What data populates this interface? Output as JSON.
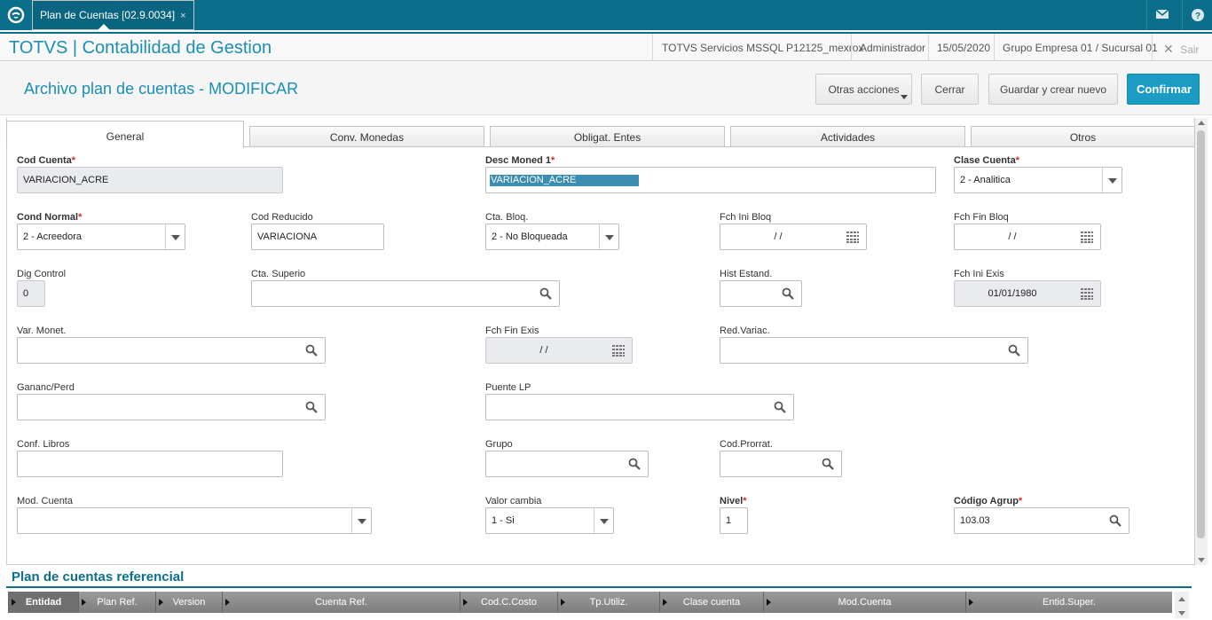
{
  "topbar": {
    "tab_label": "Plan de Cuentas [02.9.0034]",
    "tab_close": "×"
  },
  "header": {
    "app_title": "TOTVS | Contabilidad de Gestion",
    "environment": "TOTVS Servicios MSSQL P12125_mexrox",
    "user": "Administrador",
    "date": "15/05/2020",
    "company": "Grupo Empresa 01 / Sucursal 01",
    "logout": "Sair"
  },
  "page": {
    "title": "Archivo plan de cuentas - MODIFICAR",
    "actions": {
      "other": "Otras acciones",
      "close": "Cerrar",
      "save_new": "Guardar y crear nuevo",
      "confirm": "Confirmar"
    }
  },
  "tabs": [
    "General",
    "Conv. Monedas",
    "Obligat. Entes",
    "Actividades",
    "Otros"
  ],
  "form": {
    "cod_cuenta": {
      "label": "Cod Cuenta",
      "value": "VARIACION_ACRE"
    },
    "desc_moned": {
      "label": "Desc Moned 1",
      "value": "VARIACION_ACRE"
    },
    "clase_cuenta": {
      "label": "Clase Cuenta",
      "value": "2 - Analitica"
    },
    "cond_normal": {
      "label": "Cond Normal",
      "value": "2 - Acreedora"
    },
    "cod_reducido": {
      "label": "Cod Reducido",
      "value": "VARIACIONA"
    },
    "cta_bloq": {
      "label": "Cta. Bloq.",
      "value": "2 - No Bloqueada"
    },
    "fch_ini_bloq": {
      "label": "Fch Ini Bloq",
      "value": "/ /"
    },
    "fch_fin_bloq": {
      "label": "Fch Fin Bloq",
      "value": "/ /"
    },
    "dig_control": {
      "label": "Dig Control",
      "value": "0"
    },
    "cta_superio": {
      "label": "Cta. Superio",
      "value": ""
    },
    "hist_estand": {
      "label": "Hist Estand.",
      "value": ""
    },
    "fch_ini_exis": {
      "label": "Fch Ini Exis",
      "value": "01/01/1980"
    },
    "var_monet": {
      "label": "Var. Monet.",
      "value": ""
    },
    "fch_fin_exis": {
      "label": "Fch Fin Exis",
      "value": "/ /"
    },
    "red_variac": {
      "label": "Red.Variac.",
      "value": ""
    },
    "gananc_perd": {
      "label": "Gananc/Perd",
      "value": ""
    },
    "puente_lp": {
      "label": "Puente LP",
      "value": ""
    },
    "conf_libros": {
      "label": "Conf. Libros",
      "value": ""
    },
    "grupo": {
      "label": "Grupo",
      "value": ""
    },
    "cod_prorrat": {
      "label": "Cod.Prorrat.",
      "value": ""
    },
    "mod_cuenta": {
      "label": "Mod. Cuenta",
      "value": ""
    },
    "valor_cambia": {
      "label": "Valor cambia",
      "value": "1 - Si"
    },
    "nivel": {
      "label": "Nivel",
      "value": "1"
    },
    "codigo_agrup": {
      "label": "Código Agrup",
      "value": "103.03"
    }
  },
  "grid": {
    "title": "Plan de cuentas referencial",
    "columns": [
      "Entidad",
      "Plan Ref.",
      "Version",
      "Cuenta Ref.",
      "Cod.C.Costo",
      "Tp.Utiliz.",
      "Clase cuenta",
      "Mod.Cuenta",
      "Entid.Super."
    ]
  },
  "colors": {
    "brand": "#0b6f8c",
    "accent": "#1a9cc4",
    "required": "#d9232d"
  }
}
